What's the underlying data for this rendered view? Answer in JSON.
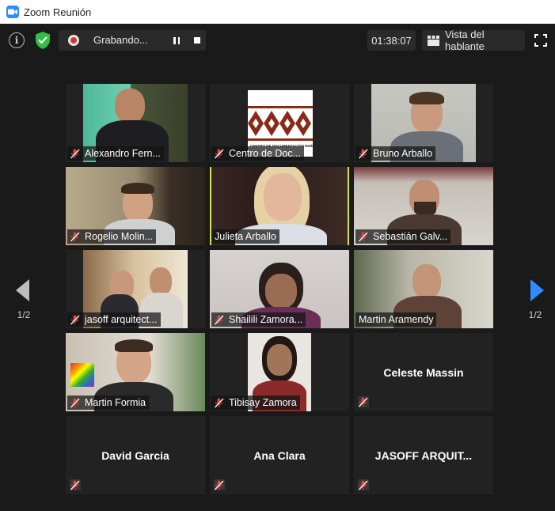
{
  "window": {
    "title": "Zoom Reunión"
  },
  "toolbar": {
    "recording_label": "Grabando...",
    "timer": "01:38:07",
    "view_button_label": "Vista del hablante"
  },
  "pagination": {
    "prev_count": "1/2",
    "next_count": "1/2"
  },
  "participants": [
    {
      "name": "Alexandro Fern...",
      "video": true
    },
    {
      "name": "Centro de Doc...",
      "video": true
    },
    {
      "name": "Bruno Arballo",
      "video": true
    },
    {
      "name": "Rogelio Molin...",
      "video": true
    },
    {
      "name": "Julieta Arballo",
      "video": true,
      "active_speaker": true
    },
    {
      "name": "Sebastián Galv...",
      "video": true
    },
    {
      "name": "jasoff arquitect...",
      "video": true
    },
    {
      "name": "Shailili Zamora...",
      "video": true
    },
    {
      "name": "Martin Aramendy",
      "video": true
    },
    {
      "name": "Martin Formia",
      "video": true
    },
    {
      "name": "Tibisay Zamora",
      "video": true
    },
    {
      "name": "Celeste Massin",
      "video": false
    },
    {
      "name": "David Garcia",
      "video": false
    },
    {
      "name": "Ana Clara",
      "video": false
    },
    {
      "name": "JASOFF ARQUIT...",
      "video": false
    }
  ],
  "logo_text": "CENTRO DE DOCUMENTACIÓN INDÍGENA",
  "colors": {
    "accent": "#2d8cff",
    "active_speaker_border": "#d7e34f",
    "mic_off": "#e5413f",
    "shield": "#2fbf47"
  }
}
